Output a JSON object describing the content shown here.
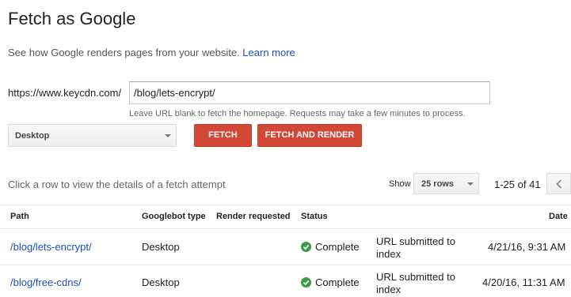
{
  "page": {
    "title": "Fetch as Google",
    "subtitle": "See how Google renders pages from your website.",
    "learn_more": "Learn more"
  },
  "form": {
    "url_prefix": "https://www.keycdn.com/",
    "url_value": "/blog/lets-encrypt/",
    "hint": "Leave URL blank to fetch the homepage. Requests may take a few minutes to process.",
    "device": "Desktop",
    "fetch_label": "FETCH",
    "fetch_render_label": "FETCH AND RENDER"
  },
  "toolbar": {
    "click_hint": "Click a row to view the details of a fetch attempt",
    "show_label": "Show",
    "rows_value": "25 rows",
    "range_text": "1-25 of 41"
  },
  "table": {
    "headers": {
      "path": "Path",
      "googlebot": "Googlebot type",
      "render": "Render requested",
      "status": "Status",
      "date": "Date"
    },
    "rows": [
      {
        "path": "/blog/lets-encrypt/",
        "googlebot": "Desktop",
        "render": "",
        "status": "Complete",
        "submitted": "URL submitted to index",
        "date": "4/21/16, 9:31 AM"
      },
      {
        "path": "/blog/free-cdns/",
        "googlebot": "Desktop",
        "render": "",
        "status": "Complete",
        "submitted": "URL submitted to index",
        "date": "4/20/16, 11:31 AM"
      }
    ]
  },
  "colors": {
    "primary_button": "#d14836",
    "link": "#1a4fbf",
    "complete": "#3c9a48"
  }
}
